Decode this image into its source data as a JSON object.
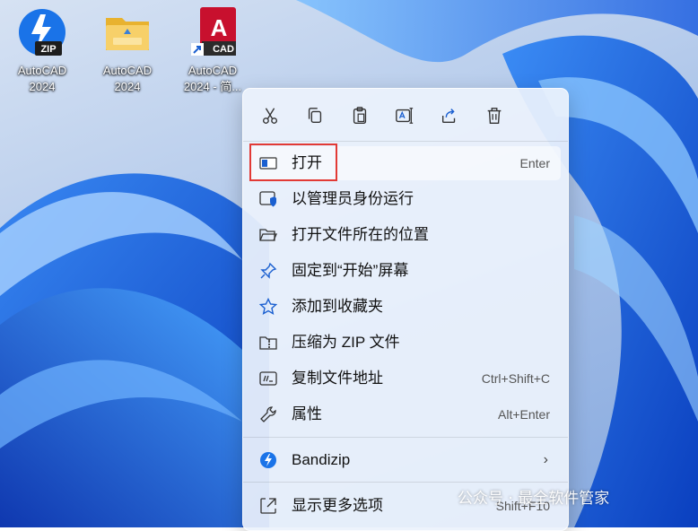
{
  "desktop": {
    "icons": [
      {
        "line1": "AutoCAD",
        "line2": "2024",
        "badge": "ZIP",
        "icon": "bandizip-archive-icon"
      },
      {
        "line1": "AutoCAD",
        "line2": "2024",
        "icon": "folder-icon"
      },
      {
        "line1": "AutoCAD",
        "line2": "2024 - 简...",
        "badge": "CAD",
        "logo_letter": "A",
        "icon": "autocad-shortcut-icon"
      }
    ]
  },
  "context_menu": {
    "toolbar": [
      "cut-icon",
      "copy-icon",
      "paste-icon",
      "rename-icon",
      "share-icon",
      "delete-icon"
    ],
    "items": [
      {
        "label": "打开",
        "shortcut": "Enter",
        "icon": "open-icon"
      },
      {
        "label": "以管理员身份运行",
        "icon": "run-as-admin-icon"
      },
      {
        "label": "打开文件所在的位置",
        "icon": "folder-open-icon"
      },
      {
        "label": "固定到“开始”屏幕",
        "icon": "pin-icon"
      },
      {
        "label": "添加到收藏夹",
        "icon": "star-icon"
      },
      {
        "label": "压缩为 ZIP 文件",
        "icon": "zip-folder-icon"
      },
      {
        "label": "复制文件地址",
        "shortcut": "Ctrl+Shift+C",
        "icon": "copy-path-icon"
      },
      {
        "label": "属性",
        "shortcut": "Alt+Enter",
        "icon": "wrench-icon"
      },
      {
        "label": "Bandizip",
        "submenu_arrow": "›",
        "icon": "bandizip-icon"
      },
      {
        "label": "显示更多选项",
        "shortcut": "Shift+F10",
        "icon": "more-options-icon"
      }
    ]
  },
  "watermark": {
    "text": "公众号 · 最全软件管家"
  },
  "colors": {
    "highlight_border": "#e23a35",
    "bandizip_blue": "#1a73e8",
    "autocad_red": "#c8102e",
    "folder_yellow": "#f3c63f"
  }
}
